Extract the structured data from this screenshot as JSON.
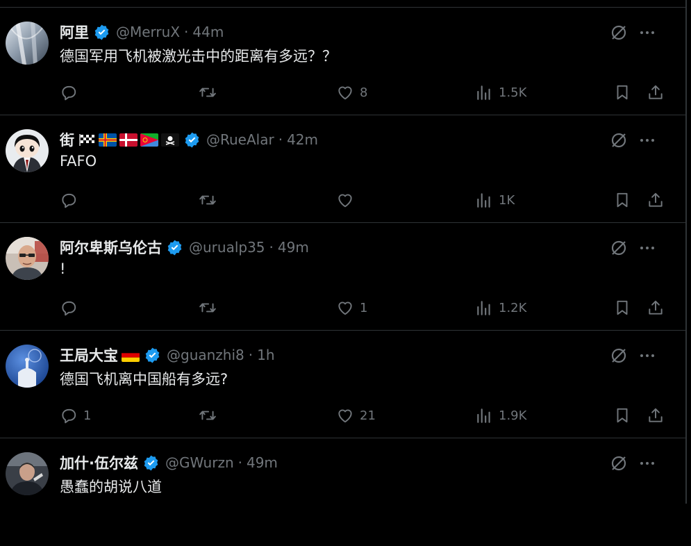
{
  "colors": {
    "background": "#000000",
    "text_primary": "#e7e9ea",
    "text_secondary": "#71767b",
    "verified_blue": "#1d9bf0",
    "divider": "#2f3336"
  },
  "icons": {
    "reply": "reply-icon",
    "retweet": "retweet-icon",
    "like": "like-icon",
    "views": "views-icon",
    "bookmark": "bookmark-icon",
    "share": "share-icon",
    "grok": "grok-icon",
    "more": "more-icon",
    "verified": "verified-badge-icon"
  },
  "tweets": [
    {
      "name": "阿里",
      "handle": "@MerruX",
      "separator": "·",
      "time": "44m",
      "text": "德国军用飞机被激光击中的距离有多远？？",
      "replies": "",
      "retweets": "",
      "likes": "8",
      "views": "1.5K",
      "verified": true
    },
    {
      "name": "街",
      "handle": "@RueAlar",
      "separator": "·",
      "time": "42m",
      "text": "FAFO",
      "replies": "",
      "retweets": "",
      "likes": "",
      "views": "1K",
      "verified": true,
      "flags": [
        "chequered-flag",
        "aland-flag",
        "denmark-flag",
        "eritrea-flag",
        "pirate-flag"
      ]
    },
    {
      "name": "阿尔卑斯乌伦古",
      "handle": "@urualp35",
      "separator": "·",
      "time": "49m",
      "text": "!",
      "replies": "",
      "retweets": "",
      "likes": "1",
      "views": "1.2K",
      "verified": true
    },
    {
      "name": "王局大宝",
      "handle": "@guanzhi8",
      "separator": "·",
      "time": "1h",
      "text": "德国飞机离中国船有多远?",
      "replies": "1",
      "retweets": "",
      "likes": "21",
      "views": "1.9K",
      "verified": true,
      "flags": [
        "germany-flag"
      ]
    },
    {
      "name": "加什·伍尔兹",
      "handle": "@GWurzn",
      "separator": "·",
      "time": "49m",
      "text": "愚蠢的胡说八道",
      "replies": "",
      "retweets": "",
      "likes": "",
      "views": "",
      "verified": true
    }
  ]
}
